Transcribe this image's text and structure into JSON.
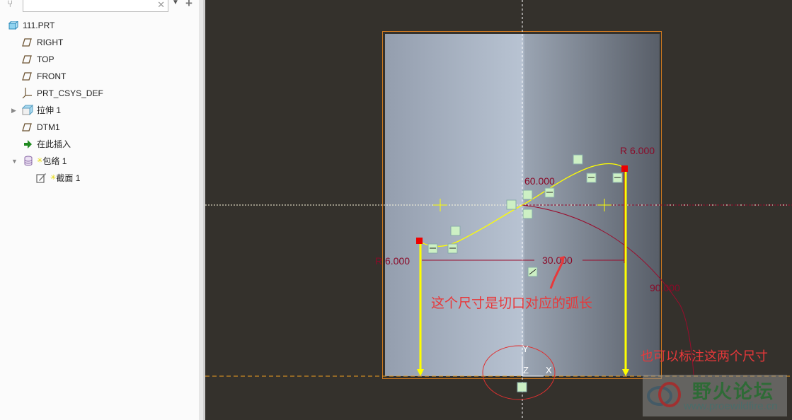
{
  "tree": {
    "search_placeholder": "",
    "items": [
      {
        "label": "111.PRT",
        "icon": "part-icon"
      },
      {
        "label": "RIGHT",
        "icon": "datum-plane-icon"
      },
      {
        "label": "TOP",
        "icon": "datum-plane-icon"
      },
      {
        "label": "FRONT",
        "icon": "datum-plane-icon"
      },
      {
        "label": "PRT_CSYS_DEF",
        "icon": "csys-icon"
      },
      {
        "label": "拉伸 1",
        "icon": "extrude-icon"
      },
      {
        "label": "DTM1",
        "icon": "datum-plane-icon"
      },
      {
        "label": "在此插入",
        "icon": "insert-arrow-icon"
      },
      {
        "label": "包络 1",
        "icon": "wrap-icon"
      },
      {
        "label": "截面 1",
        "icon": "sketch-icon"
      }
    ]
  },
  "sketch": {
    "dim_radius_right": "R 6.000",
    "dim_radius_left": "R 6.000",
    "dim_angle": "60.000",
    "dim_length": "30.000",
    "dim_arc": "90.000",
    "axis_y": "Y",
    "axis_z": "Z",
    "axis_x": "X"
  },
  "annotations": {
    "note_arc_length": "这个尺寸是切口对应的弧长",
    "note_alt_dims": "也可以标注这两个尺寸"
  },
  "watermark": {
    "title": "野火论坛",
    "url": "www.proewildfire.cn"
  },
  "colors": {
    "dimension": "#9a0c2c",
    "sketch": "#ffff00",
    "annotation": "#e8383a",
    "canvas": "#34312c"
  }
}
